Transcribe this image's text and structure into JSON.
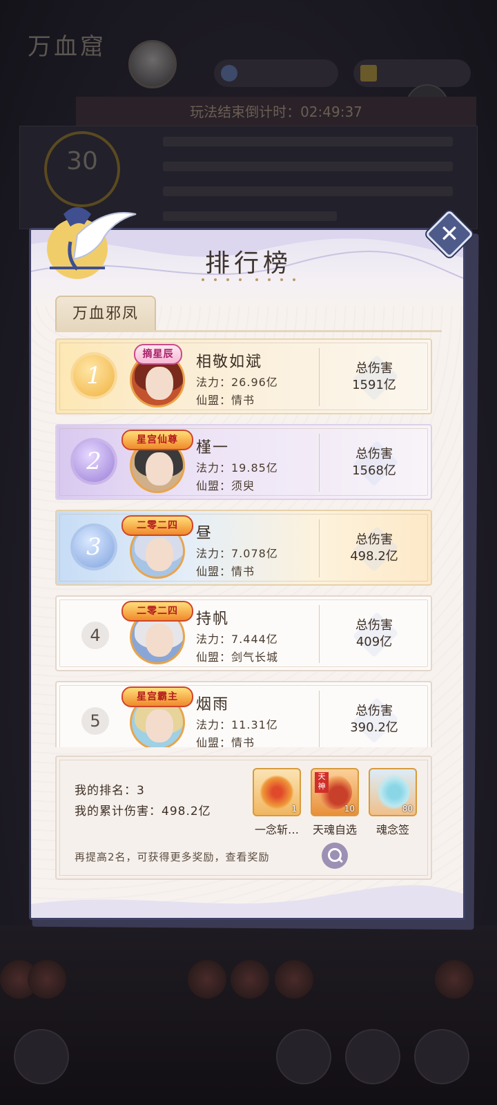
{
  "background": {
    "title": "万血窟",
    "countdown": "玩法结束倒计时：02:49:37",
    "timer_value": "30"
  },
  "modal": {
    "title": "排行榜",
    "tab_label": "万血邪凤",
    "close_icon": "close-icon"
  },
  "ranking": [
    {
      "rank": "1",
      "name": "相敬如斌",
      "power": "法力：26.96亿",
      "guild": "仙盟：情书",
      "damage_label": "总伤害",
      "damage": "1591亿",
      "badge": "摘星辰"
    },
    {
      "rank": "2",
      "name": "槿一",
      "power": "法力：19.85亿",
      "guild": "仙盟：须臾",
      "damage_label": "总伤害",
      "damage": "1568亿",
      "badge": "星宫仙尊"
    },
    {
      "rank": "3",
      "name": "昼",
      "power": "法力：7.078亿",
      "guild": "仙盟：情书",
      "damage_label": "总伤害",
      "damage": "498.2亿",
      "badge": "二零二四"
    },
    {
      "rank": "4",
      "name": "持帆",
      "power": "法力：7.444亿",
      "guild": "仙盟：剑气长城",
      "damage_label": "总伤害",
      "damage": "409亿",
      "badge": "二零二四"
    },
    {
      "rank": "5",
      "name": "烟雨",
      "power": "法力：11.31亿",
      "guild": "仙盟：情书",
      "damage_label": "总伤害",
      "damage": "390.2亿",
      "badge": "星宫霸主"
    }
  ],
  "my_panel": {
    "my_rank": "我的排名：3",
    "my_damage": "我的累计伤害：498.2亿",
    "hint": "再提高2名，可获得更多奖励，查看奖励",
    "rewards": [
      {
        "label": "一念斩…",
        "count": "1"
      },
      {
        "label": "天魂自选",
        "count": "10",
        "tag": "天神"
      },
      {
        "label": "魂念签",
        "count": "80"
      }
    ]
  }
}
